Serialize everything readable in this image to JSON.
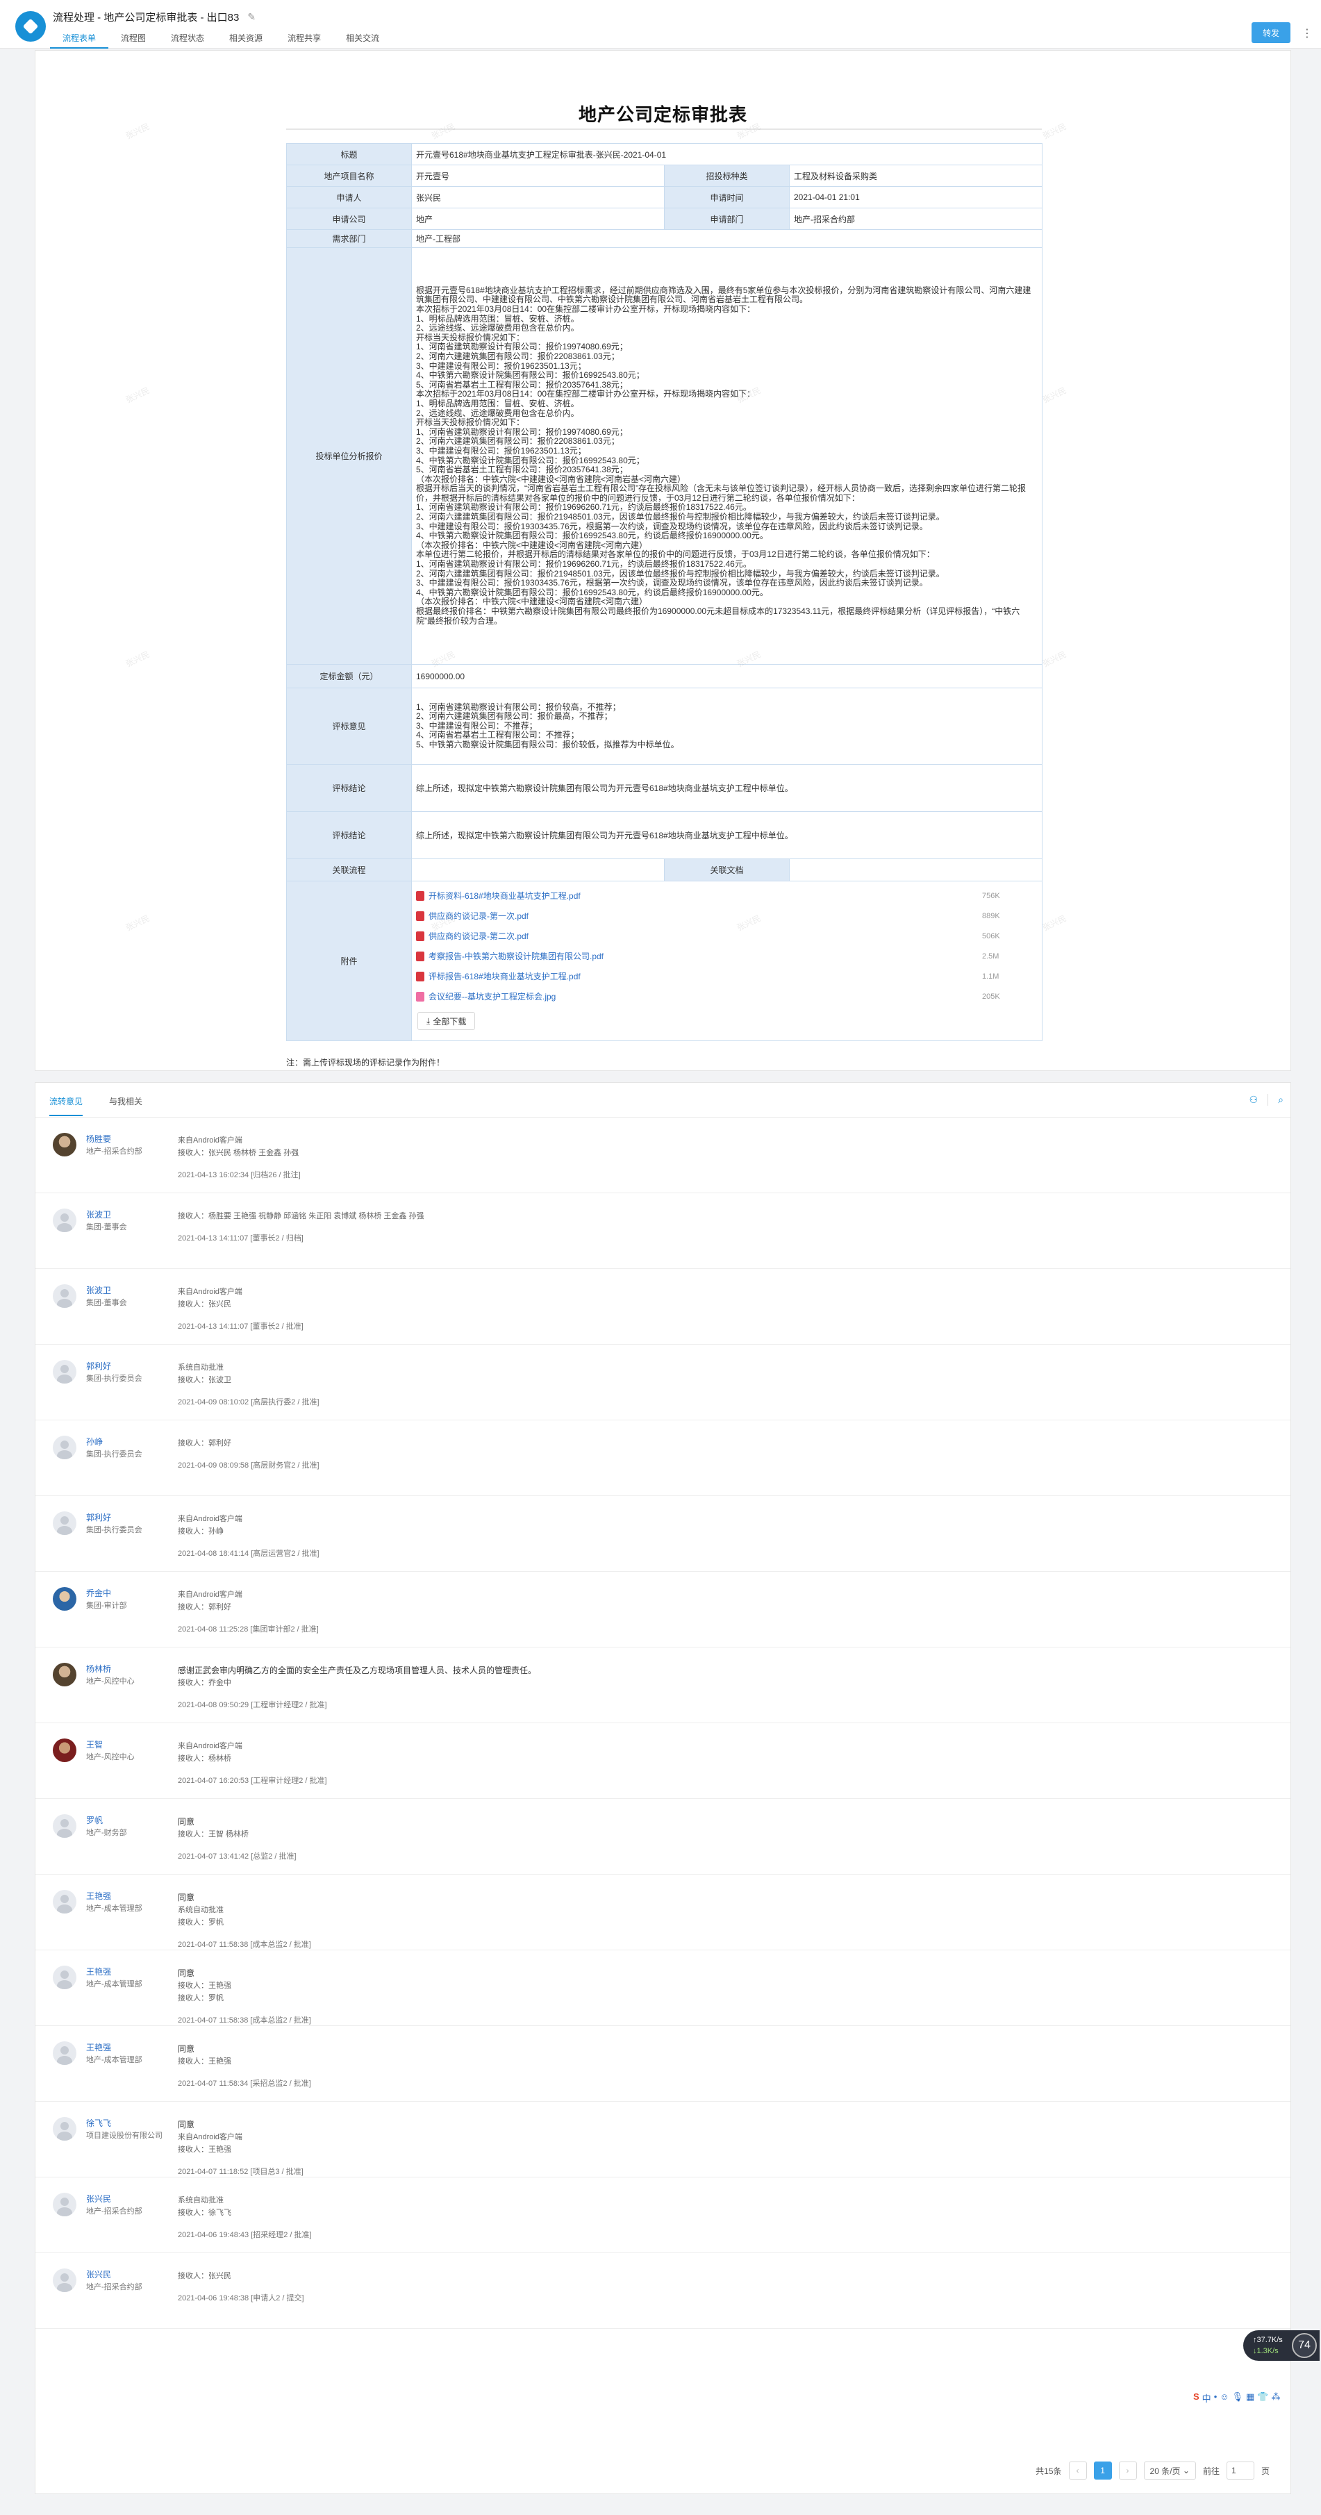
{
  "header": {
    "breadcrumb": "流程处理 - 地产公司定标审批表 - 出口83",
    "tabs": [
      "流程表单",
      "流程图",
      "流程状态",
      "相关资源",
      "流程共享",
      "相关交流"
    ],
    "action_button": "转发"
  },
  "form": {
    "title": "地产公司定标审批表",
    "labels": {
      "title": "标题",
      "project": "地产项目名称",
      "bid_type": "招投标种类",
      "applicant": "申请人",
      "apply_time": "申请时间",
      "company": "申请公司",
      "dept": "申请部门",
      "demand_dept": "需求部门",
      "analysis": "投标单位分析报价",
      "amount": "定标金额（元）",
      "opinion": "评标意见",
      "conclusion1": "评标结论",
      "conclusion2": "评标结论",
      "related_flow": "关联流程",
      "related_doc": "关联文档",
      "attachments": "附件"
    },
    "values": {
      "title": "开元壹号618#地块商业基坑支护工程定标审批表-张兴民-2021-04-01",
      "project": "开元壹号",
      "bid_type": "工程及材料设备采购类",
      "applicant": "张兴民",
      "apply_time": "2021-04-01 21:01",
      "company": "地产",
      "dept": "地产-招采合约部",
      "demand_dept": "地产-工程部",
      "analysis": "根据开元壹号618#地块商业基坑支护工程招标需求，经过前期供应商筛选及入围，最终有5家单位参与本次投标报价，分别为河南省建筑勘察设计有限公司、河南六建建筑集团有限公司、中建建设有限公司、中铁第六勘察设计院集团有限公司、河南省岩基岩土工程有限公司。\n    本次招标于2021年03月08日14：00在集控部二楼审计办公室开标，开标现场揭晓内容如下：\n1、明标品牌选用范围：冒桩、安桩、济桩。\n2、远途线缆、远途爆破费用包含在总价内。\n    开标当天投标报价情况如下：\n1、河南省建筑勘察设计有限公司：报价19974080.69元；\n2、河南六建建筑集团有限公司：报价22083861.03元；\n3、中建建设有限公司：报价19623501.13元；\n4、中铁第六勘察设计院集团有限公司：报价16992543.80元；\n5、河南省岩基岩土工程有限公司：报价20357641.38元；\n    本次招标于2021年03月08日14：00在集控部二楼审计办公室开标，开标现场揭晓内容如下：\n1、明标品牌选用范围：冒桩、安桩、济桩。\n2、远途线缆、远途爆破费用包含在总价内。\n    开标当天投标报价情况如下：\n1、河南省建筑勘察设计有限公司：报价19974080.69元；\n2、河南六建建筑集团有限公司：报价22083861.03元；\n3、中建建设有限公司：报价19623501.13元；\n4、中铁第六勘察设计院集团有限公司：报价16992543.80元；\n5、河南省岩基岩土工程有限公司：报价20357641.38元；\n（本次报价排名：中铁六院<中建建设<河南省建院<河南岩基<河南六建）\n    根据开标后当天的谈判情况，“河南省岩基岩土工程有限公司”存在投标风险（含无未与该单位签订谈判记录），经开标人员协商一致后，选择剩余四家单位进行第二轮报价，并根据开标后的清标结果对各家单位的报价中的问题进行反馈，于03月12日进行第二轮约谈，各单位报价情况如下：\n1、河南省建筑勘察设计有限公司：报价19696260.71元，约谈后最终报价18317522.46元。\n2、河南六建建筑集团有限公司：报价21948501.03元，因该单位最终报价与控制报价相比降幅较少，与我方偏差较大，约谈后未签订谈判记录。\n3、中建建设有限公司：报价19303435.76元，根据第一次约谈，调查及现场约谈情况，该单位存在违章风险，因此约谈后未签订谈判记录。\n4、中铁第六勘察设计院集团有限公司：报价16992543.80元，约谈后最终报价16900000.00元。\n（本次报价排名：中铁六院<中建建设<河南省建院<河南六建）\n本单位进行第二轮报价，并根据开标后的清标结果对各家单位的报价中的问题进行反馈，于03月12日进行第二轮约谈，各单位报价情况如下：\n1、河南省建筑勘察设计有限公司：报价19696260.71元，约谈后最终报价18317522.46元。\n2、河南六建建筑集团有限公司：报价21948501.03元，因该单位最终报价与控制报价相比降幅较少，与我方偏差较大，约谈后未签订谈判记录。\n3、中建建设有限公司：报价19303435.76元，根据第一次约谈，调查及现场约谈情况，该单位存在违章风险，因此约谈后未签订谈判记录。\n4、中铁第六勘察设计院集团有限公司：报价16992543.80元，约谈后最终报价16900000.00元。\n（本次报价排名：中铁六院<中建建设<河南省建院<河南六建）\n    根据最终报价排名：中铁第六勘察设计院集团有限公司最终报价为16900000.00元未超目标成本的17323543.11元，根据最终评标结果分析（详见评标报告），“中铁六院”最终报价较为合理。",
      "amount": "16900000.00",
      "opinion": "1、河南省建筑勘察设计有限公司：报价较高，不推荐；\n2、河南六建建筑集团有限公司：报价最高，不推荐；\n3、中建建设有限公司：不推荐；\n4、河南省岩基岩土工程有限公司：不推荐；\n5、中铁第六勘察设计院集团有限公司：报价较低，拟推荐为中标单位。",
      "conclusion1": "综上所述，现拟定中铁第六勘察设计院集团有限公司为开元壹号618#地块商业基坑支护工程中标单位。",
      "conclusion2": "综上所述，现拟定中铁第六勘察设计院集团有限公司为开元壹号618#地块商业基坑支护工程中标单位。"
    },
    "attachments": [
      {
        "name": "开标资料-618#地块商业基坑支护工程.pdf",
        "size": "756K",
        "type": "pdf"
      },
      {
        "name": "供应商约谈记录-第一次.pdf",
        "size": "889K",
        "type": "pdf"
      },
      {
        "name": "供应商约谈记录-第二次.pdf",
        "size": "506K",
        "type": "pdf"
      },
      {
        "name": "考察报告-中铁第六勘察设计院集团有限公司.pdf",
        "size": "2.5M",
        "type": "pdf"
      },
      {
        "name": "评标报告-618#地块商业基坑支护工程.pdf",
        "size": "1.1M",
        "type": "pdf"
      },
      {
        "name": "会议纪要--基坑支护工程定标会.jpg",
        "size": "205K",
        "type": "img"
      }
    ],
    "download_all": "全部下载",
    "note": "注：需上传评标现场的评标记录作为附件！"
  },
  "comments_panel": {
    "tabs": [
      "流转意见",
      "与我相关"
    ],
    "items": [
      {
        "name": "杨胜要",
        "dept": "地产-招采合约部",
        "lines": [
          "来自Android客户端",
          "接收人：张兴民 杨林桥 王金鑫 孙强"
        ],
        "meta": "2021-04-13 16:02:34  [归档26 / 批注]",
        "avatar": "photo"
      },
      {
        "name": "张波卫",
        "dept": "集团-董事会",
        "lines": [
          "接收人：杨胜要 王艳强 祝静静 邱涵铭 朱正阳 袁博斌 杨林桥 王金鑫 孙强"
        ],
        "meta": "2021-04-13 14:11:07  [董事长2 / 归档]",
        "avatar": "blank"
      },
      {
        "name": "张波卫",
        "dept": "集团-董事会",
        "lines": [
          "来自Android客户端",
          "接收人：张兴民"
        ],
        "meta": "2021-04-13 14:11:07  [董事长2 / 批准]",
        "avatar": "blank"
      },
      {
        "name": "郭利好",
        "dept": "集团-执行委员会",
        "lines": [
          "系统自动批准",
          "接收人：张波卫"
        ],
        "meta": "2021-04-09 08:10:02  [高层执行委2 / 批准]",
        "avatar": "blank"
      },
      {
        "name": "孙峥",
        "dept": "集团-执行委员会",
        "lines": [
          "接收人：郭利好"
        ],
        "meta": "2021-04-09 08:09:58  [高层财务官2 / 批准]",
        "avatar": "blank"
      },
      {
        "name": "郭利好",
        "dept": "集团-执行委员会",
        "lines": [
          "来自Android客户端",
          "接收人：孙峥"
        ],
        "meta": "2021-04-08 18:41:14  [高层运营官2 / 批准]",
        "avatar": "blank"
      },
      {
        "name": "乔金中",
        "dept": "集团-审计部",
        "lines": [
          "来自Android客户端",
          "接收人：郭利好"
        ],
        "meta": "2021-04-08 11:25:28  [集团审计部2 / 批准]",
        "avatar": "photo2"
      },
      {
        "name": "杨林桥",
        "dept": "地产-风控中心",
        "lines": [
          "感谢正武会审内明确乙方的全面的安全生产责任及乙方现场项目管理人员、技术人员的管理责任。",
          "接收人：乔金中"
        ],
        "meta": "2021-04-08 09:50:29  [工程审计经理2 / 批准]",
        "avatar": "photo"
      },
      {
        "name": "王智",
        "dept": "地产-风控中心",
        "lines": [
          "来自Android客户端",
          "接收人：杨林桥"
        ],
        "meta": "2021-04-07 16:20:53  [工程审计经理2 / 批准]",
        "avatar": "photo3"
      },
      {
        "name": "罗帆",
        "dept": "地产-财务部",
        "lines": [
          "同意",
          "接收人：王智 杨林桥"
        ],
        "meta": "2021-04-07 13:41:42  [总监2 / 批准]",
        "avatar": "blank"
      },
      {
        "name": "王艳强",
        "dept": "地产-成本管理部",
        "lines": [
          "同意",
          "系统自动批准",
          "接收人：罗帆"
        ],
        "meta": "2021-04-07 11:58:38  [成本总监2 / 批准]",
        "avatar": "blank"
      },
      {
        "name": "王艳强",
        "dept": "地产-成本管理部",
        "lines": [
          "同意",
          "接收人：王艳强",
          "接收人：罗帆"
        ],
        "meta": "2021-04-07 11:58:38  [成本总监2 / 批准]",
        "avatar": "blank"
      },
      {
        "name": "王艳强",
        "dept": "地产-成本管理部",
        "lines": [
          "同意",
          "接收人：王艳强"
        ],
        "meta": "2021-04-07 11:58:34  [采招总监2 / 批准]",
        "avatar": "blank"
      },
      {
        "name": "徐飞飞",
        "dept": "项目建设股份有限公司",
        "lines": [
          "同意",
          "来自Android客户端",
          "接收人：王艳强"
        ],
        "meta": "2021-04-07 11:18:52  [项目总3 / 批准]",
        "avatar": "blank"
      },
      {
        "name": "张兴民",
        "dept": "地产-招采合约部",
        "lines": [
          "系统自动批准",
          "接收人：徐飞飞"
        ],
        "meta": "2021-04-06 19:48:43  [招采经理2 / 批准]",
        "avatar": "blank"
      },
      {
        "name": "张兴民",
        "dept": "地产-招采合约部",
        "lines": [
          "接收人：张兴民"
        ],
        "meta": "2021-04-06 19:48:38  [申请人2 / 提交]",
        "avatar": "blank"
      }
    ],
    "pager": {
      "total": "共15条",
      "current": "1",
      "page_size": "20 条/页",
      "goto_label": "前往",
      "goto_value": "1",
      "goto_suffix": "页"
    }
  },
  "float_widget": {
    "line1": "↑37.7K/s",
    "line2": "↓1.3K/s",
    "num": "74"
  },
  "ime_bar": [
    "S",
    "中",
    "•",
    "☺",
    "🎙",
    "▦",
    "👕",
    "⁂"
  ]
}
